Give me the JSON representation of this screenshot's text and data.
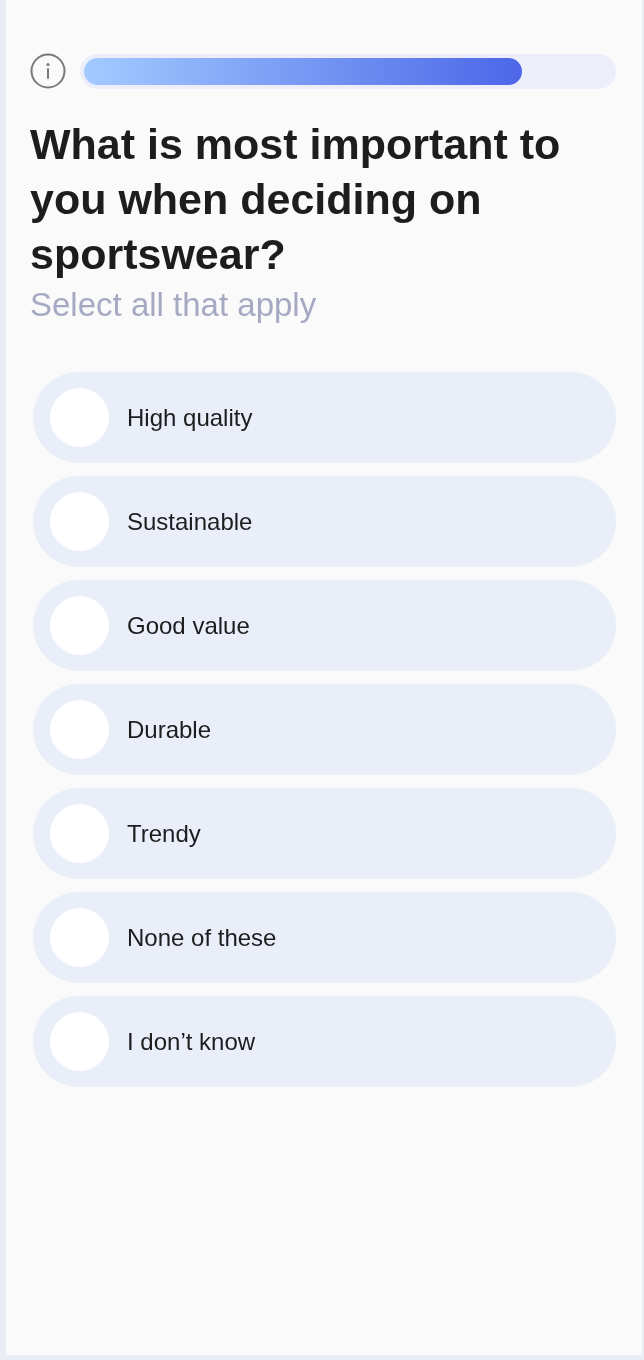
{
  "progress": {
    "level": 0.83
  },
  "question": {
    "title": "What is most important to you when deciding on sportswear?",
    "subtitle": "Select all that apply"
  },
  "options": [
    {
      "label": "High quality",
      "selected": false
    },
    {
      "label": "Sustainable",
      "selected": false
    },
    {
      "label": "Good value",
      "selected": false
    },
    {
      "label": "Durable",
      "selected": false
    },
    {
      "label": "Trendy",
      "selected": false
    },
    {
      "label": "None of these",
      "selected": false
    },
    {
      "label": "I don’t know",
      "selected": false
    }
  ]
}
